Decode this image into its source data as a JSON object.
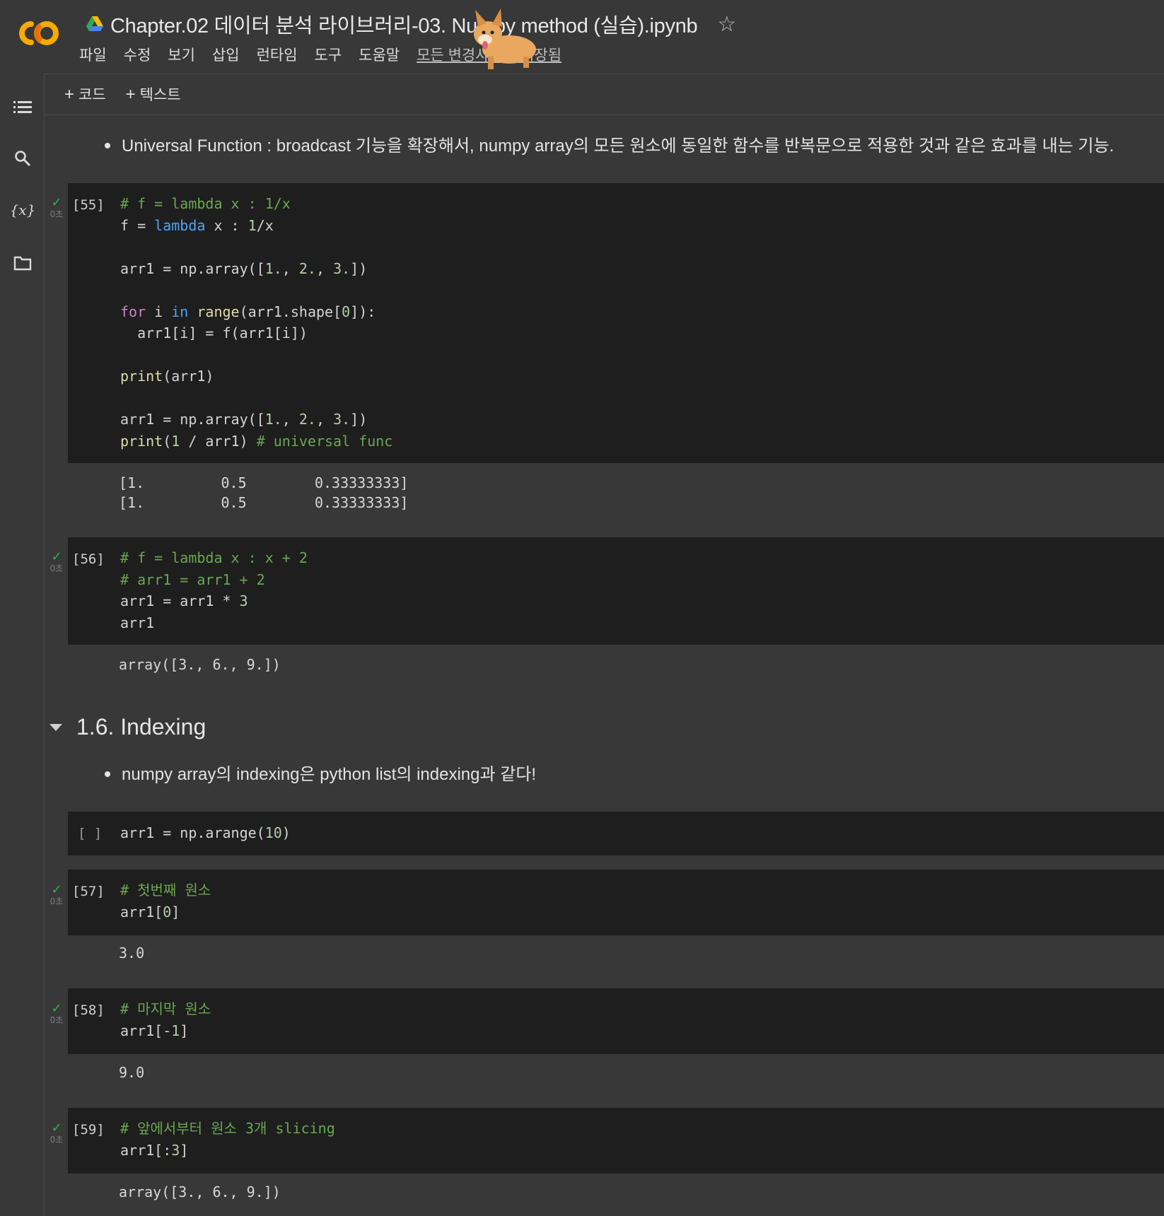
{
  "header": {
    "title": "Chapter.02 데이터 분석 라이브러리-03. Numpy method (실습).ipynb",
    "menu": [
      "파일",
      "수정",
      "보기",
      "삽입",
      "런타임",
      "도구",
      "도움말"
    ],
    "save_status": "모든 변경사항이 저장됨"
  },
  "toolbar": {
    "add_code": "코드",
    "add_text": "텍스트"
  },
  "text_cells": {
    "ufunc": "Universal Function : broadcast 기능을 확장해서, numpy array의 모든 원소에 동일한 함수를 반복문으로 적용한 것과 같은 효과를 내는 기능.",
    "indexing_note": "numpy array의 indexing은 python list의 indexing과 같다!"
  },
  "section_heading": "1.6. Indexing",
  "cells": [
    {
      "count": "[55]",
      "duration": "0초",
      "output": "[1.         0.5        0.33333333]\n[1.         0.5        0.33333333]"
    },
    {
      "count": "[56]",
      "duration": "0초",
      "output": "array([3., 6., 9.])"
    },
    {
      "count": "[ ]"
    },
    {
      "count": "[57]",
      "duration": "0초",
      "output": "3.0"
    },
    {
      "count": "[58]",
      "duration": "0초",
      "output": "9.0"
    },
    {
      "count": "[59]",
      "duration": "0초",
      "output": "array([3., 6., 9.])"
    }
  ],
  "colors": {
    "comment": "#6aa84f",
    "keyword": "#4fa3f7",
    "control": "#c586c0",
    "builtin": "#dcdcaa",
    "number": "#b5cea8",
    "success": "#2fb344"
  }
}
